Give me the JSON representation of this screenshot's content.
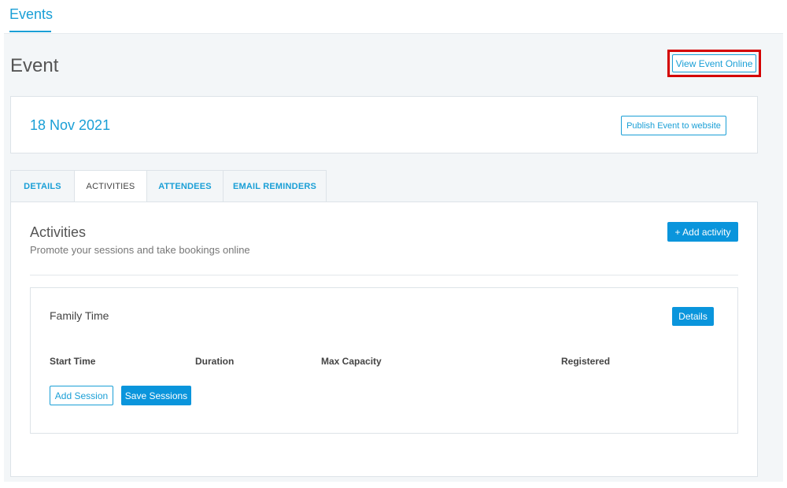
{
  "topnav": {
    "tab_label": "Events"
  },
  "page": {
    "title": "Event"
  },
  "header_actions": {
    "view_online_label": "View Event Online"
  },
  "event": {
    "date": "18 Nov 2021",
    "publish_label": "Publish Event to website"
  },
  "tabs": [
    {
      "label": "DETAILS",
      "active": false
    },
    {
      "label": "ACTIVITIES",
      "active": true
    },
    {
      "label": "ATTENDEES",
      "active": false
    },
    {
      "label": "EMAIL REMINDERS",
      "active": false
    }
  ],
  "activities": {
    "title": "Activities",
    "subtitle": "Promote your sessions and take bookings online",
    "add_label": "+ Add activity",
    "items": [
      {
        "name": "Family Time",
        "details_label": "Details",
        "columns": [
          "Start Time",
          "Duration",
          "Max Capacity",
          "Registered"
        ],
        "add_session_label": "Add Session",
        "save_sessions_label": "Save Sessions"
      }
    ]
  },
  "colors": {
    "accent": "#1a9fd6",
    "primary_button": "#0a95dc",
    "highlight": "#d40000"
  }
}
